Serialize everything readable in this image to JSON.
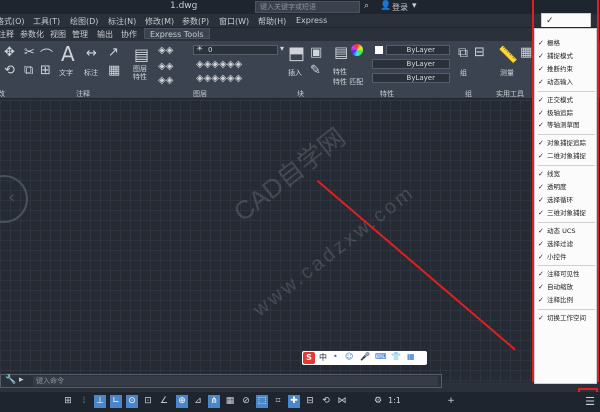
{
  "titlebar": {
    "doc_title": "1.dwg",
    "search_placeholder": "键入关键字或短语",
    "login": "登录"
  },
  "menubar": {
    "items": [
      "格式(O)",
      "工具(T)",
      "绘图(D)",
      "标注(N)",
      "修改(M)",
      "参数(P)",
      "窗口(W)",
      "帮助(H)",
      "Express"
    ]
  },
  "tabs": {
    "items": [
      "注释",
      "参数化",
      "视图",
      "管理",
      "输出",
      "协作",
      "Express Tools"
    ],
    "active": "Express Tools"
  },
  "ribbon": {
    "layer_value": "0",
    "text_button": "文字",
    "dim_button": "标注",
    "layer_props_button": "图层\n特性",
    "insert_button": "插入",
    "props_button": "特性",
    "match_button": "特性\n匹配",
    "group_button": "组",
    "measure_button": "测量",
    "bylayer_1": "ByLayer",
    "bylayer_2": "ByLayer",
    "bylayer_3": "ByLayer",
    "panels": [
      "改",
      "注释",
      "图层",
      "块",
      "特性",
      "组",
      "实用工具"
    ]
  },
  "watermark": {
    "line1": "CAD自学网",
    "line2": "www.cadzxw.com"
  },
  "ime": {
    "s_logo": "S",
    "items": [
      "中",
      "•",
      "☺",
      "🎤",
      "⌨",
      "👕",
      "▦"
    ]
  },
  "cmdline": {
    "placeholder": "键入命令"
  },
  "statusbar": {
    "scale": "1:1",
    "items": [
      "⊞",
      "⦙",
      "⊥",
      "∟",
      "⊙",
      "⊡",
      "∠",
      "⊕",
      "⊿",
      "⋔",
      "▦",
      "⊘",
      "⬚",
      "⌗",
      "✚",
      "⊟",
      "⟲",
      "⋈",
      "⚙",
      "+"
    ]
  },
  "custom_menu": {
    "top_check": "✓",
    "items": [
      {
        "label": "栅格",
        "checked": true
      },
      {
        "label": "捕捉模式",
        "checked": true
      },
      {
        "label": "推断约束",
        "checked": true
      },
      {
        "label": "动态输入",
        "checked": true
      },
      {
        "sep": true
      },
      {
        "label": "正交模式",
        "checked": true
      },
      {
        "label": "极轴追踪",
        "checked": true
      },
      {
        "label": "等轴测草图",
        "checked": true
      },
      {
        "sep": true
      },
      {
        "label": "对象捕捉追踪",
        "checked": true
      },
      {
        "label": "二维对象捕捉",
        "checked": true
      },
      {
        "sep": true
      },
      {
        "label": "线宽",
        "checked": true
      },
      {
        "label": "透明度",
        "checked": true
      },
      {
        "label": "选择循环",
        "checked": true
      },
      {
        "label": "三维对象捕捉",
        "checked": true
      },
      {
        "sep": true
      },
      {
        "label": "动态 UCS",
        "checked": true
      },
      {
        "label": "选择过滤",
        "checked": true
      },
      {
        "label": "小控件",
        "checked": true
      },
      {
        "sep": true
      },
      {
        "label": "注释可见性",
        "checked": true
      },
      {
        "label": "自动缩放",
        "checked": true
      },
      {
        "label": "注释比例",
        "checked": true
      },
      {
        "sep": true
      },
      {
        "label": "切换工作空间",
        "checked": true
      }
    ]
  },
  "colors": {
    "accent_red": "#e02020",
    "status_on": "#4a86c8"
  }
}
